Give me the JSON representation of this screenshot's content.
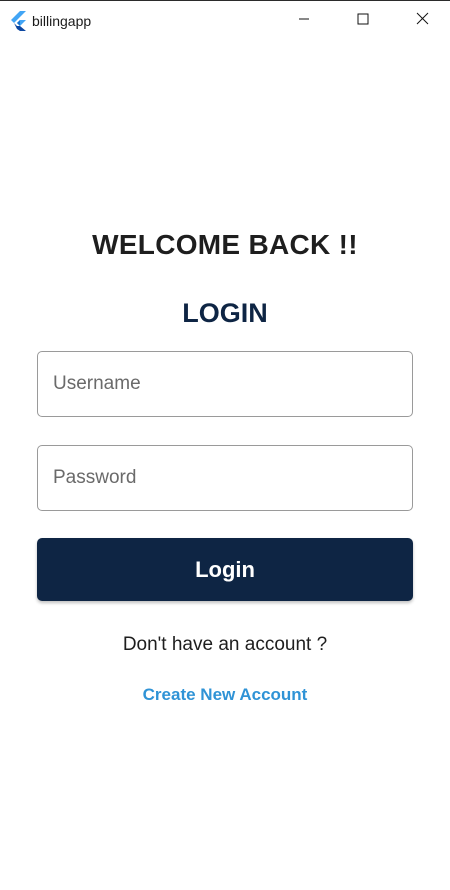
{
  "window": {
    "title": "billingapp",
    "icon": "flutter-logo-icon",
    "controls": [
      "minimize-icon",
      "maximize-icon",
      "close-icon"
    ]
  },
  "main": {
    "welcome_text": "WELCOME BACK !!",
    "login_heading": "LOGIN",
    "username": {
      "placeholder": "Username",
      "value": ""
    },
    "password": {
      "placeholder": "Password",
      "value": ""
    },
    "login_button_label": "Login",
    "no_account_text": "Don't have an account ?",
    "create_account_link": "Create New Account"
  },
  "colors": {
    "primary": "#0e2544",
    "link": "#2f93d6",
    "border": "#9a9a9a"
  }
}
